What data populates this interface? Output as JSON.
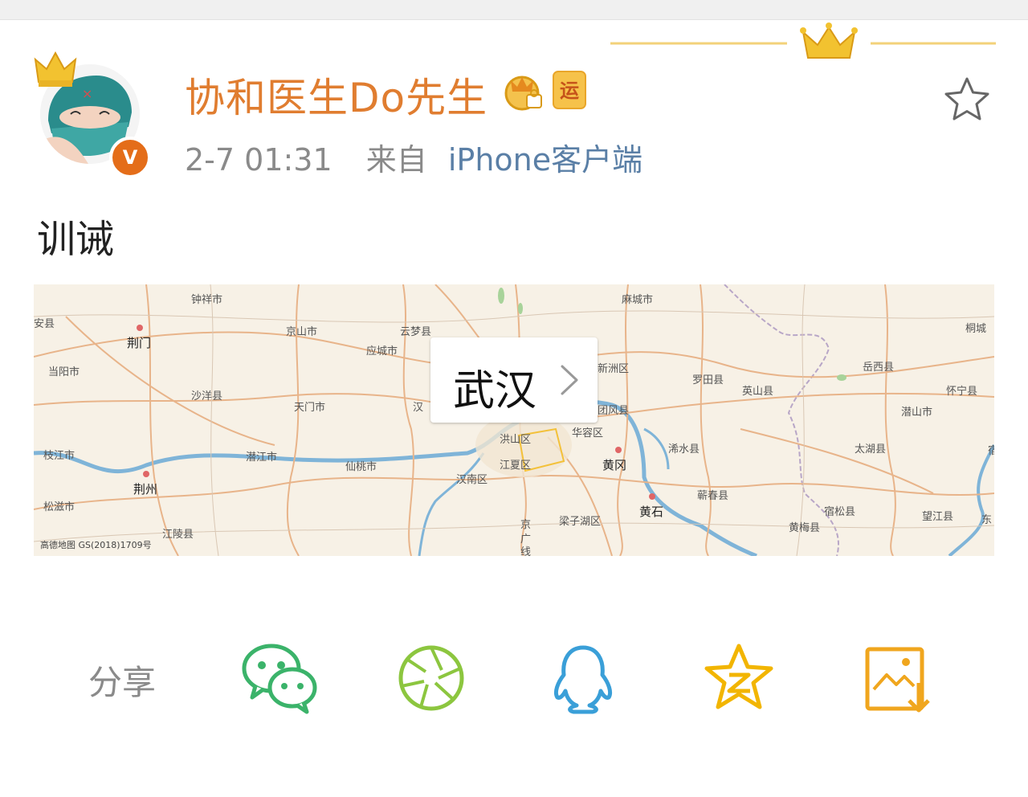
{
  "post": {
    "username": "协和医生Do先生",
    "time": "2-7 01:31",
    "from_label": "来自",
    "source": "iPhone客户端",
    "badge_yun": "运",
    "content": "训诫",
    "verified_mark": "V"
  },
  "location": {
    "name": "武汉"
  },
  "map": {
    "labels": {
      "an_xian": "安县",
      "jingmen": "荆门",
      "dangyang": "当阳市",
      "zhongxiang": "钟祥市",
      "jingshan": "京山市",
      "yunmeng": "云梦县",
      "yingcheng": "应城市",
      "macheng": "麻城市",
      "shayang": "沙洋县",
      "tianmen": "天门市",
      "han": "汉",
      "xinzhou": "新洲区",
      "tuanfeng": "团风县",
      "huarong": "华容区",
      "luotian": "罗田县",
      "yingshan": "英山县",
      "yuexi": "岳西县",
      "qianshan": "潜山市",
      "huaining": "怀宁县",
      "tongcheng": "桐城",
      "zhijiang": "枝江市",
      "jingzhou": "荆州",
      "songzi": "松滋市",
      "jiangling": "江陵县",
      "qianjiang": "潜江市",
      "xiantao": "仙桃市",
      "jiangxia": "江夏区",
      "hongshan": "洪山区",
      "hannan": "汉南区",
      "huanggang": "黄冈",
      "xishui": "浠水县",
      "qichun": "蕲春县",
      "huangshi": "黄石",
      "liangzihu": "梁子湖区",
      "huangmei": "黄梅县",
      "susong": "宿松县",
      "wangjiang": "望江县",
      "taihu": "太湖县",
      "dong": "东",
      "jing": "京",
      "guang": "广",
      "xian": "线",
      "su": "宿"
    },
    "copyright": "高德地图 GS(2018)1709号"
  },
  "share": {
    "label": "分享",
    "buttons": [
      "wechat",
      "moments",
      "qq",
      "qzone",
      "save-image"
    ]
  },
  "colors": {
    "username": "#e07d30",
    "source_link": "#5a7fa6",
    "meta_gray": "#8a8a8a",
    "wechat": "#3bb36a",
    "moments": "#8cc63f",
    "qq": "#3a9fd8",
    "qzone": "#f2b500",
    "save": "#f0a61e"
  }
}
